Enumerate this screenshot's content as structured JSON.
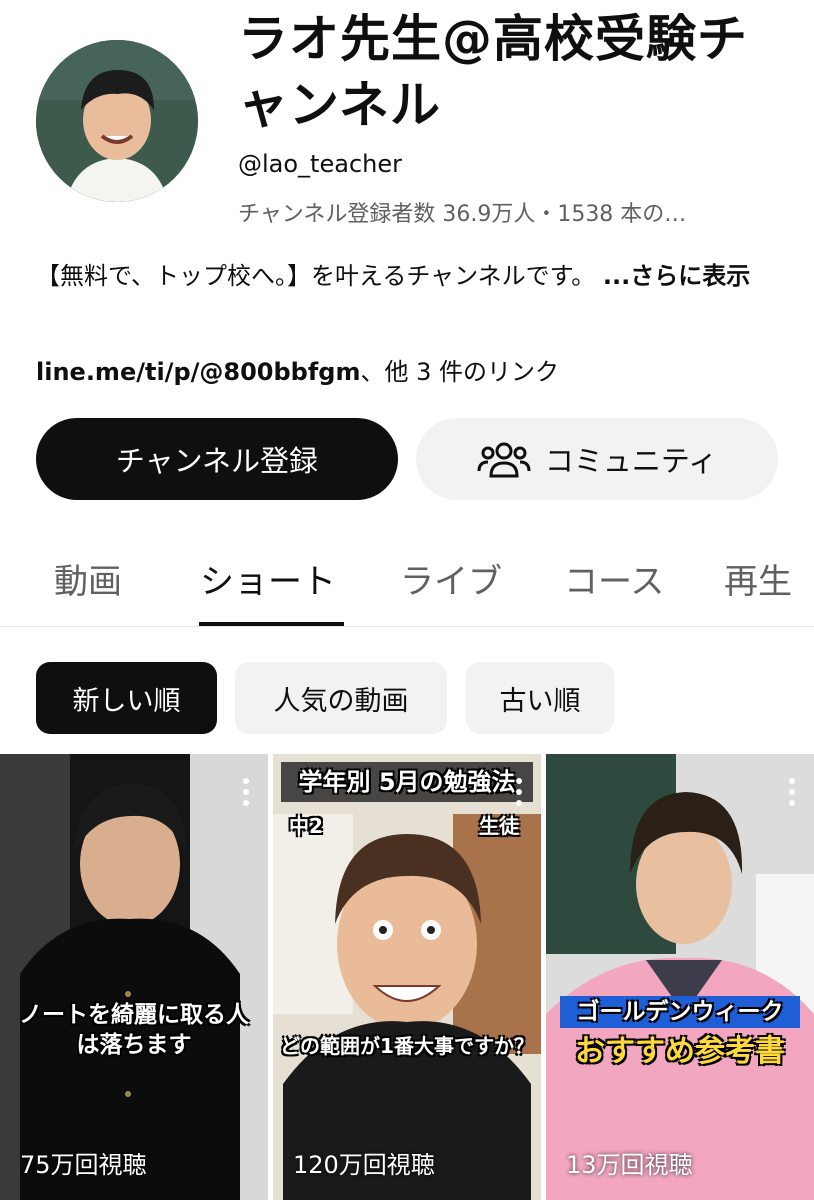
{
  "channel": {
    "title": "ラオ先生@高校受験チャンネル",
    "handle": "@lao_teacher",
    "stats": "チャンネル登録者数 36.9万人・1538 本の…",
    "description": "【無料で、トップ校へ。】を叶えるチャンネルです。",
    "description_more": "...さらに表示",
    "link_url": "line.me/ti/p/@800bbfgm",
    "link_more": "、他 3 件のリンク"
  },
  "buttons": {
    "subscribe": "チャンネル登録",
    "community": "コミュニティ"
  },
  "tabs": [
    {
      "label": "動画"
    },
    {
      "label": "ショート",
      "active": true
    },
    {
      "label": "ライブ"
    },
    {
      "label": "コース"
    },
    {
      "label": "再生"
    }
  ],
  "chips": [
    {
      "label": "新しい順",
      "active": true
    },
    {
      "label": "人気の動画"
    },
    {
      "label": "古い順"
    }
  ],
  "shorts": [
    {
      "caption": "ノートを綺麗に取る人は落ちます",
      "views": "75万回視聴"
    },
    {
      "top_caption": "学年別 5月の勉強法",
      "tag_left": "中2",
      "tag_right": "生徒",
      "caption": "どの範囲が1番大事ですか？",
      "views": "120万回視聴"
    },
    {
      "caption_top": "ゴールデンウィーク",
      "caption": "おすすめ参考書",
      "views": "13万回視聴"
    }
  ]
}
